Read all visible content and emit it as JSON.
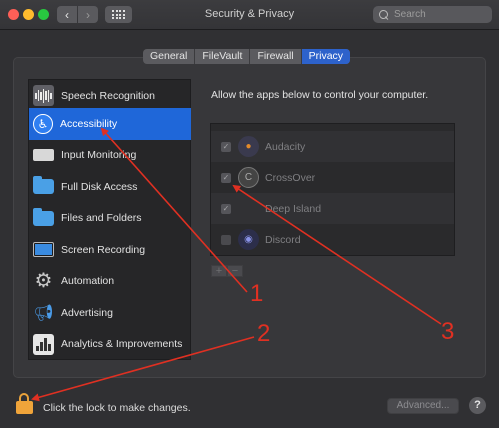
{
  "window": {
    "title": "Security & Privacy",
    "search_placeholder": "Search"
  },
  "toolbar": {
    "back_glyph": "‹",
    "forward_glyph": "›"
  },
  "tabs": [
    {
      "label": "General",
      "active": false
    },
    {
      "label": "FileVault",
      "active": false
    },
    {
      "label": "Firewall",
      "active": false
    },
    {
      "label": "Privacy",
      "active": true
    }
  ],
  "sidebar": {
    "items": [
      {
        "label": "Speech Recognition",
        "icon": "waveform-icon"
      },
      {
        "label": "Accessibility",
        "icon": "accessibility-icon",
        "selected": true
      },
      {
        "label": "Input Monitoring",
        "icon": "keyboard-icon"
      },
      {
        "label": "Full Disk Access",
        "icon": "folder-icon"
      },
      {
        "label": "Files and Folders",
        "icon": "folder-icon"
      },
      {
        "label": "Screen Recording",
        "icon": "display-icon"
      },
      {
        "label": "Automation",
        "icon": "gear-icon"
      },
      {
        "label": "Advertising",
        "icon": "megaphone-icon"
      },
      {
        "label": "Analytics & Improvements",
        "icon": "bar-chart-icon"
      }
    ]
  },
  "main": {
    "intro": "Allow the apps below to control your computer.",
    "apps": [
      {
        "name": "Audacity",
        "checked": true
      },
      {
        "name": "CrossOver",
        "checked": true
      },
      {
        "name": "Deep Island",
        "checked": true
      },
      {
        "name": "Discord",
        "checked": false
      }
    ],
    "add_glyph": "+",
    "remove_glyph": "−"
  },
  "footer": {
    "lock_text": "Click the lock to make changes.",
    "advanced_label": "Advanced...",
    "help_label": "?"
  },
  "annotations": {
    "labels": [
      "1",
      "2",
      "3"
    ],
    "color": "#e03022"
  },
  "colors": {
    "accent": "#1f67d9",
    "lock": "#f0a43a"
  }
}
